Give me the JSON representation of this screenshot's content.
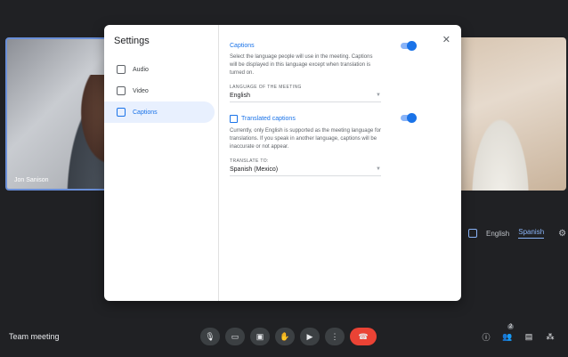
{
  "tiles": {
    "left_name": "Jon Sanison"
  },
  "caption_bar": {
    "languages": [
      "English",
      "Spanish"
    ]
  },
  "meeting": {
    "title": "Team meeting",
    "participant_count": "2"
  },
  "dialog": {
    "title": "Settings",
    "nav": [
      {
        "label": "Audio"
      },
      {
        "label": "Video"
      },
      {
        "label": "Captions"
      }
    ],
    "captions": {
      "title": "Captions",
      "description": "Select the language people will use in the meeting. Captions will be displayed in this language except when translation is turned on.",
      "field_label": "LANGUAGE OF THE MEETING",
      "value": "English",
      "enabled": true
    },
    "translated": {
      "title": "Translated captions",
      "description": "Currently, only English is supported as the meeting language for translations. If you speak in another language, captions will be inaccurate or not appear.",
      "field_label": "TRANSLATE TO:",
      "value": "Spanish (Mexico)",
      "enabled": true
    }
  },
  "colors": {
    "accent": "#1a73e8",
    "end_call": "#ea4335",
    "background": "#202124"
  }
}
